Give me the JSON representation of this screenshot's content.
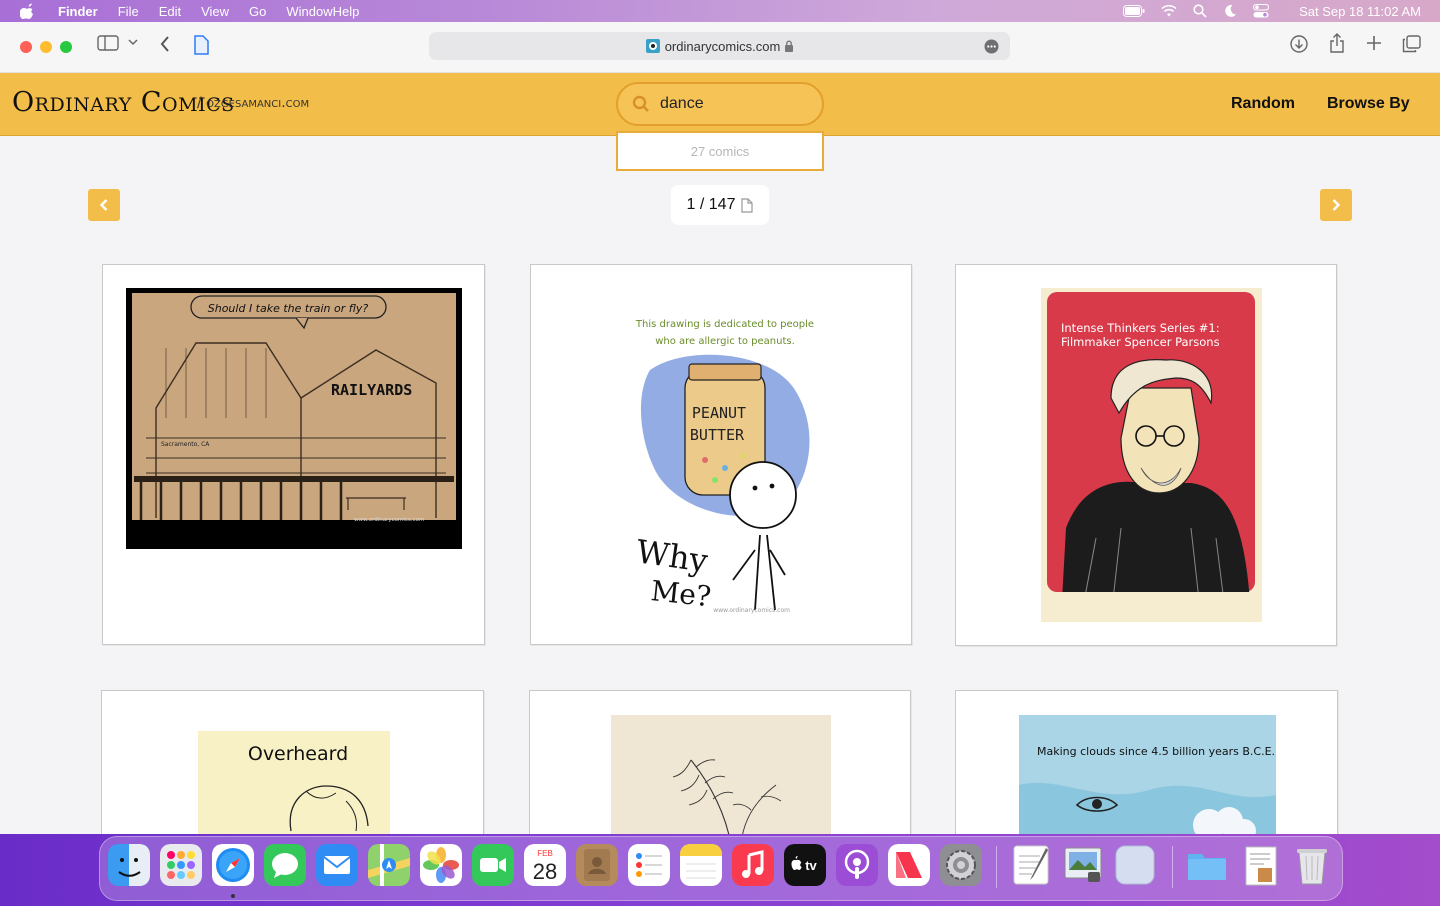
{
  "menubar": {
    "app_name": "Finder",
    "items": [
      "File",
      "Edit",
      "View",
      "Go",
      "Window",
      "Help"
    ],
    "clock": "Sat Sep 18  11:02 AM"
  },
  "browser": {
    "url": "ordinarycomics.com"
  },
  "site": {
    "brand": "Ordinary Comics",
    "brand_sub": "/ ozgesamanci.com",
    "search_value": "dance",
    "search_result_count": "27 comics",
    "nav": [
      "Random",
      "Browse By"
    ],
    "page_indicator": "1 / 147"
  },
  "comics": [
    {
      "speech_bubble": "Should I take the train or fly?",
      "sign": "RAILYARDS",
      "small_sign": "Sacramento, CA",
      "watermark": "www.ordinarycomics.com"
    },
    {
      "caption_line1": "This drawing is dedicated to people",
      "caption_line2": "who are allergic to peanuts.",
      "jar_line1": "PEANUT",
      "jar_line2": "BUTTER",
      "why_line1": "Why",
      "why_line2": "Me?",
      "watermark": "www.ordinarycomics.com"
    },
    {
      "title_line1": "Intense Thinkers Series #1:",
      "title_line2": "Filmmaker Spencer Parsons"
    },
    {
      "title": "Overheard"
    },
    {},
    {
      "caption": "Making clouds since 4.5 billion years B.C.E."
    }
  ],
  "dock": {
    "calendar_month": "FEB",
    "calendar_day": "28",
    "tv_label": "tv"
  }
}
